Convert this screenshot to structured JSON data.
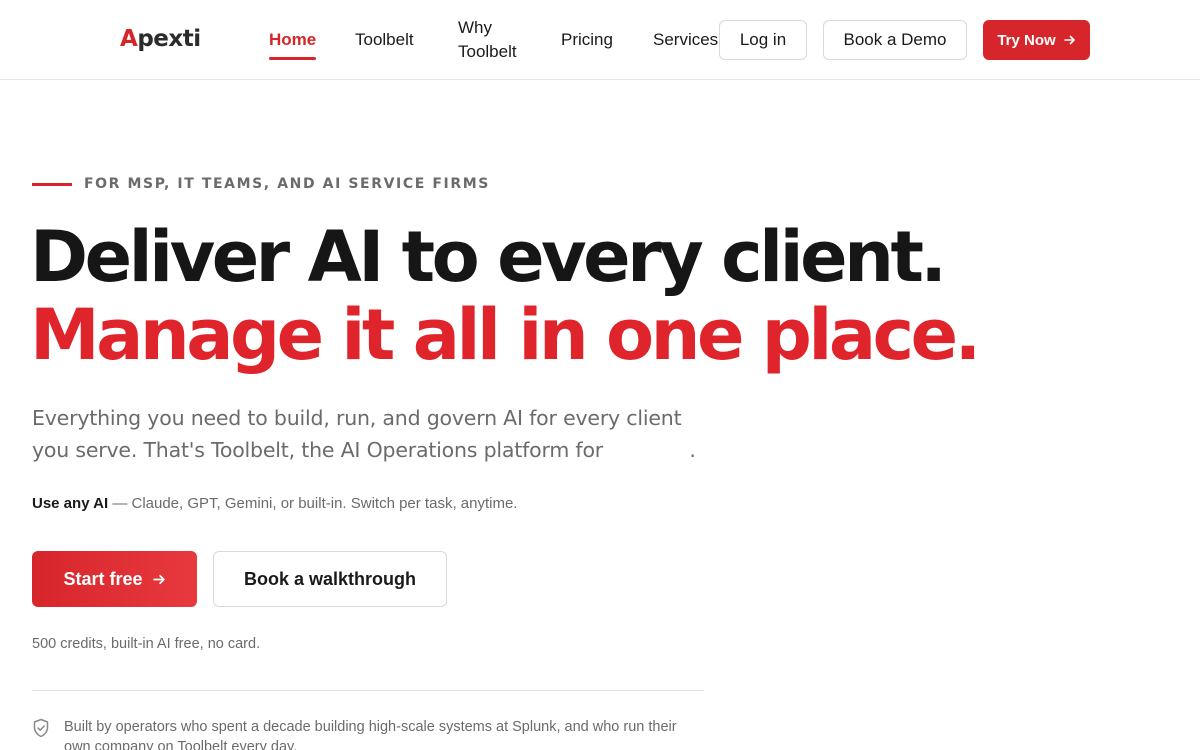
{
  "logo": {
    "first": "A",
    "rest": "pexti"
  },
  "nav": {
    "home": "Home",
    "toolbelt": "Toolbelt",
    "why_toolbelt": "Why Toolbelt",
    "pricing": "Pricing",
    "services": "Services"
  },
  "header_buttons": {
    "login": "Log in",
    "demo": "Book a Demo",
    "try": "Try Now",
    "try_icon": "arrow-right-icon"
  },
  "hero": {
    "eyebrow": "FOR MSP, IT TEAMS, AND AI SERVICE FIRMS",
    "headline_1": "Deliver AI to every client.",
    "headline_2": "Manage it all in one place.",
    "subhead_a": "Everything you need to build, run, and govern AI for every client you serve. That's Toolbelt, the AI Operations platform for",
    "subhead_end": ".",
    "useai_label": "Use any AI",
    "useai_text": " — Claude, GPT, Gemini, or built-in. Switch per task, anytime.",
    "start_button": "Start free",
    "walkthrough_button": "Book a walkthrough",
    "credits": "500 credits, built-in AI free, no card.",
    "trust_text": "Built by operators who spent a decade building high-scale systems at Splunk, and who run their own company on Toolbelt every day."
  },
  "colors": {
    "accent": "#d7262b",
    "headline_dark": "#161616",
    "muted": "#6b6b6b",
    "border": "#d9d9d9"
  }
}
